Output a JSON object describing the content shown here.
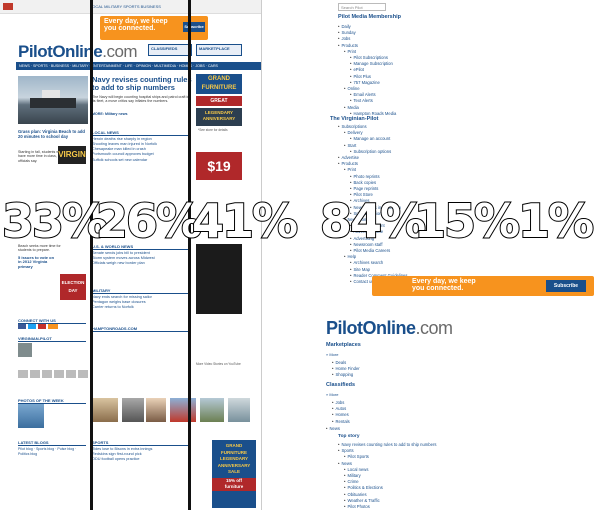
{
  "left_page": {
    "topbar_links": "LOCAL  MILITARY  SPORTS  BUSINESS",
    "ad_top": {
      "text_line1": "Every day, we keep",
      "text_line2": "you connected.",
      "button": "Subscribe"
    },
    "logo": {
      "main": "PilotOnline",
      "suffix": ".com"
    },
    "classified_label": "CLASSIFIEDS",
    "marketplace_label": "MARKETPLACE",
    "nav_items": "NEWS · SPORTS · BUSINESS · MILITARY · ENTERTAINMENT · LIFE · OPINION · MULTIMEDIA · HOMES · JOBS · CARS",
    "main_headline": "Navy revises counting rules to add to ship numbers",
    "main_body": "The Navy will begin counting hospital ships and patrol craft in its fleet, a move critics say inflates the numbers.",
    "more_news": "MORE: Military news",
    "side_headline": "Grass plan: Virginia Beach to add 20 minutes to school day",
    "side_body": "Starting in fall, students will have more time in class, officials say.",
    "local_news_head": "LOCAL NEWS",
    "local_news_items": [
      "Heroin deaths rise sharply in region",
      "Shooting leaves man injured in Norfolk",
      "Chesapeake man killed in crash",
      "Portsmouth council approves budget",
      "Suffolk schools set new calendar"
    ],
    "sports_head": "U.S. & WORLD NEWS",
    "sports_items": [
      "Senate sends jobs bill to president",
      "Storm system moves across Midwest",
      "Officials weigh new border plan"
    ],
    "military_head": "MILITARY",
    "military_items": [
      "Navy ends search for missing sailor",
      "Pentagon weighs base closures",
      "Carrier returns to Norfolk"
    ],
    "hamptonroads_head": "HAMPTONROADS.COM",
    "election_label": "ELECTION DAY",
    "election_text": "5 issues to vote on in 2012 Virginia primary",
    "photos_head": "PHOTOS OF THE WEEK",
    "connect_head": "CONNECT WITH US",
    "virginia_head": "VIRGINIAN-PILOT",
    "ad_grand": {
      "line1": "GRAND",
      "line2": "FURNITURE",
      "line3": "LEGENDARY",
      "line4": "ANNIVERSARY",
      "line5": "SALE",
      "line6": "15% off",
      "line7": "furniture"
    },
    "price_ad": "$19",
    "gas_ad": "GREAT",
    "caption_ad": "*See store for details",
    "sports2_head": "SPORTS",
    "sports2_items": [
      "Tides lose to Bisons in extra innings",
      "Redskins sign first-round pick",
      "ODU football opens practice"
    ],
    "blogs_head": "LATEST BLOGS",
    "video_caption": "More Video Stories on YouTube"
  },
  "right_page": {
    "search_placeholder": "Search Pilot",
    "title_membership": "Pilot Media Membership",
    "membership_items": [
      {
        "level": 1,
        "text": "Daily"
      },
      {
        "level": 1,
        "text": "Sunday"
      },
      {
        "level": 1,
        "text": "Jobs"
      },
      {
        "level": 1,
        "text": "Products"
      },
      {
        "level": 2,
        "text": "Print"
      },
      {
        "level": 3,
        "text": "Pilot Subscriptions"
      },
      {
        "level": 3,
        "text": "Manage Subscription"
      },
      {
        "level": 3,
        "text": "ePilot"
      },
      {
        "level": 3,
        "text": "Pilot Plus"
      },
      {
        "level": 3,
        "text": "757 Magazine"
      },
      {
        "level": 2,
        "text": "Online"
      },
      {
        "level": 3,
        "text": "Email Alerts"
      },
      {
        "level": 3,
        "text": "Text Alerts"
      },
      {
        "level": 2,
        "text": "Media"
      },
      {
        "level": 3,
        "text": "Hampton Roads Media"
      }
    ],
    "title_virginian": "The Virginian-Pilot",
    "virginian_items": [
      {
        "level": 1,
        "text": "Subscriptions"
      },
      {
        "level": 2,
        "text": "Delivery"
      },
      {
        "level": 3,
        "text": "Manage an account"
      },
      {
        "level": 2,
        "text": "Start"
      },
      {
        "level": 3,
        "text": "Subscription options"
      },
      {
        "level": 1,
        "text": "Advertise"
      },
      {
        "level": 1,
        "text": "Products"
      },
      {
        "level": 2,
        "text": "Print"
      },
      {
        "level": 3,
        "text": "Photo reprints"
      },
      {
        "level": 3,
        "text": "Back copies"
      },
      {
        "level": 3,
        "text": "Page reprints"
      },
      {
        "level": 3,
        "text": "Pilot Store"
      },
      {
        "level": 3,
        "text": "Archives"
      },
      {
        "level": 3,
        "text": "Newspapers in Education"
      },
      {
        "level": 3,
        "text": "Special sections"
      },
      {
        "level": 2,
        "text": "Newsroom"
      },
      {
        "level": 3,
        "text": "Advertise in print"
      },
      {
        "level": 3,
        "text": "Advertise online"
      },
      {
        "level": 3,
        "text": "Advertising"
      },
      {
        "level": 3,
        "text": "Newsroom staff"
      },
      {
        "level": 3,
        "text": "Pilot Media Careers"
      },
      {
        "level": 2,
        "text": "Help"
      },
      {
        "level": 3,
        "text": "Archives search"
      },
      {
        "level": 3,
        "text": "Site Map"
      },
      {
        "level": 3,
        "text": "Reader Comment Guidelines"
      },
      {
        "level": 3,
        "text": "Contact us"
      }
    ],
    "ad_bottom": {
      "text_line1": "Every day, we keep",
      "text_line2": "you connected.",
      "button": "Subscribe"
    },
    "logo": {
      "main": "PilotOnline",
      "suffix": ".com"
    },
    "marketplaces_head": "Marketplaces",
    "marketplaces_more": "» More",
    "marketplaces_items": [
      {
        "level": 1,
        "text": "Deals"
      },
      {
        "level": 1,
        "text": "Home Finder"
      },
      {
        "level": 1,
        "text": "Shopping"
      }
    ],
    "classifieds_head": "Classifieds",
    "classifieds_more": "» More",
    "classifieds_items": [
      {
        "level": 1,
        "text": "Jobs"
      },
      {
        "level": 1,
        "text": "Autos"
      },
      {
        "level": 1,
        "text": "Homes"
      },
      {
        "level": 1,
        "text": "Rentals"
      }
    ],
    "news_label": "News",
    "topstory_label": "Top story",
    "topstory_items": [
      {
        "level": 2,
        "text": "Navy revises counting rules to add to ship numbers"
      },
      {
        "level": 2,
        "text": "Sports"
      },
      {
        "level": 3,
        "text": "Pilot Sports"
      },
      {
        "level": 2,
        "text": "News"
      },
      {
        "level": 3,
        "text": "Local news"
      },
      {
        "level": 3,
        "text": "Military"
      },
      {
        "level": 3,
        "text": "Crime"
      },
      {
        "level": 3,
        "text": "Politics & Elections"
      },
      {
        "level": 3,
        "text": "Obituaries"
      },
      {
        "level": 3,
        "text": "Weather & Traffic"
      },
      {
        "level": 3,
        "text": "Pilot Photos"
      },
      {
        "level": 2,
        "text": "Business"
      }
    ]
  },
  "overlays": [
    "33%",
    "26%",
    "41%",
    "84%",
    "15%",
    "1%"
  ],
  "colors": {
    "brand_blue": "#1a4f8b",
    "accent_orange": "#f7931e",
    "ad_red": "#b0282a"
  }
}
